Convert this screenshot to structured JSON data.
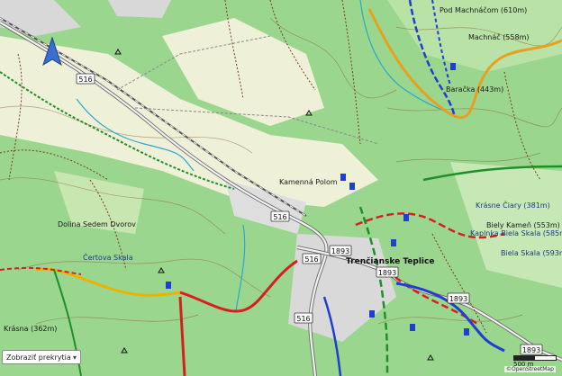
{
  "map": {
    "road_numbers": [
      "516",
      "1893"
    ],
    "town_label": "Trenčianske Teplice",
    "place_labels": [
      "Pod Machnáčom (610m)",
      "Machnáč (558m)",
      "Baračka (443m)",
      "Biely Kameň (553m)",
      "Krásne Čiary (381m)",
      "Kaplnka Biela Skala (585m)",
      "Biela Skala (593m)",
      "Kamenná Polom",
      "Čertova Skala",
      "Dolina Sedem Dvorov",
      "Krásna (362m)"
    ],
    "overlay_select": {
      "value": "Zobraziť prekrytia",
      "chevron": "chevron-down-icon"
    },
    "scale": {
      "label": "500 m"
    },
    "attribution": "©OpenStreetMap",
    "colors": {
      "forest": "#8fd18a",
      "forest_light": "#b9e3a6",
      "meadow": "#eef0d8",
      "urban": "#d8d8d8",
      "trail_red": "#d62020",
      "trail_blue": "#1f3fcf",
      "trail_green": "#1f8f2a",
      "trail_yellow": "#e8b400",
      "road_main": "#e8a020",
      "contour": "#8a5a2a",
      "stream": "#2aa9c9"
    }
  }
}
